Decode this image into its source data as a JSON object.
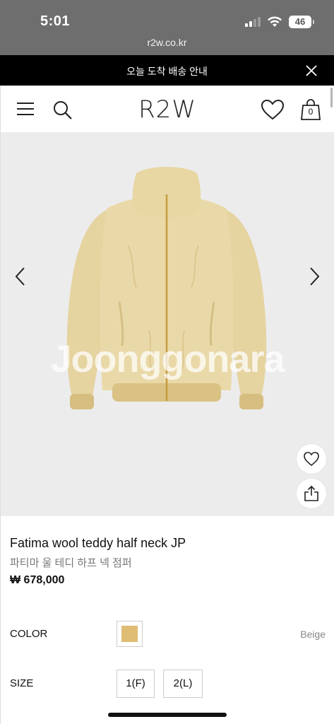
{
  "status_bar": {
    "time": "5:01",
    "battery": "46",
    "url": "r2w.co.kr"
  },
  "notice": {
    "text": "오늘 도착 배송 안내"
  },
  "header": {
    "logo": "R2W",
    "cart_count": "0",
    "icons": [
      "menu-icon",
      "search-icon",
      "heart-icon",
      "shopping-bag-icon"
    ]
  },
  "gallery": {
    "watermark": "Joonggonara",
    "icons": [
      "chevron-left-icon",
      "chevron-right-icon",
      "heart-icon",
      "share-icon"
    ],
    "background_color": "#ececec"
  },
  "product": {
    "name": "Fatima wool teddy half neck JP",
    "name_ko": "파티마 울 테디 하프 넥 점퍼",
    "price": "₩ 678,000"
  },
  "options": {
    "color_label": "COLOR",
    "color_value": "Beige",
    "swatch_color": "#dfbd72",
    "size_label": "SIZE",
    "sizes": [
      "1(F)",
      "2(L)"
    ]
  }
}
